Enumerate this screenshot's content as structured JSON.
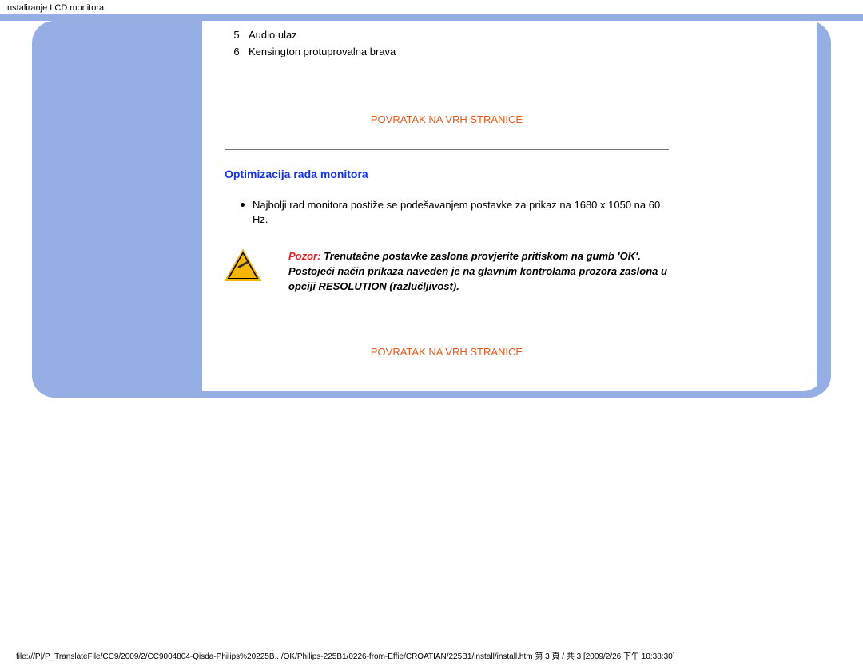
{
  "header": {
    "title": "Instaliranje LCD monitora"
  },
  "items": [
    {
      "num": "5",
      "label": "Audio ulaz"
    },
    {
      "num": "6",
      "label": "Kensington protuprovalna brava"
    }
  ],
  "links": {
    "back_to_top_1": "POVRATAK NA VRH STRANICE",
    "back_to_top_2": "POVRATAK NA VRH STRANICE"
  },
  "section": {
    "heading": "Optimizacija rada monitora",
    "bullet": "Najbolji rad monitora postiže se podešavanjem postavke za prikaz na 1680 x 1050 na 60 Hz."
  },
  "note": {
    "label": "Pozor:",
    "text": "Trenutačne postavke zaslona provjerite pritiskom na gumb 'OK'. Postojeći način prikaza naveden je na glavnim kontrolama prozora zaslona u opciji RESOLUTION (razlučljivost)."
  },
  "footer": {
    "path": "file:///P|/P_TranslateFile/CC9/2009/2/CC9004804-Qisda-Philips%20225B.../OK/Philips-225B1/0226-from-Effie/CROATIAN/225B1/install/install.htm 第 3 頁 / 共 3  [2009/2/26 下午 10:38:30]"
  }
}
